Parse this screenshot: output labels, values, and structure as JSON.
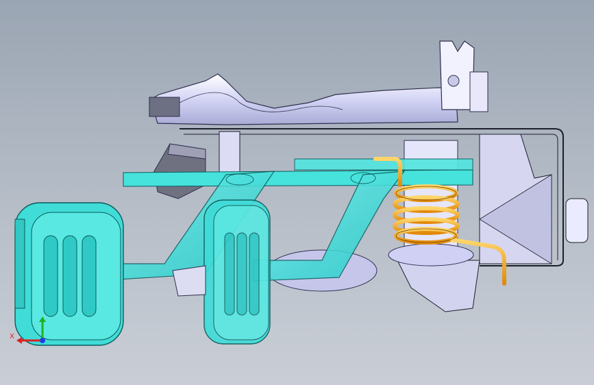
{
  "scene": {
    "subject": "cad-assembly-pedal-mechanism",
    "background_top": "#9aa5b3",
    "background_bottom": "#c9ced6",
    "colors": {
      "pedal_part": "#3fe0dc",
      "pedal_part_edge": "#0b5a5a",
      "housing_part": "#cfd0f4",
      "housing_edge": "#2e2f4e",
      "spring": "#f4a81c",
      "spring_edge": "#7a4a00",
      "frame_edge": "#1c1f2a"
    }
  },
  "triad": {
    "x_label": "X",
    "x_color": "#e02020",
    "y_color": "#20b020",
    "z_color": "#2040e0"
  }
}
